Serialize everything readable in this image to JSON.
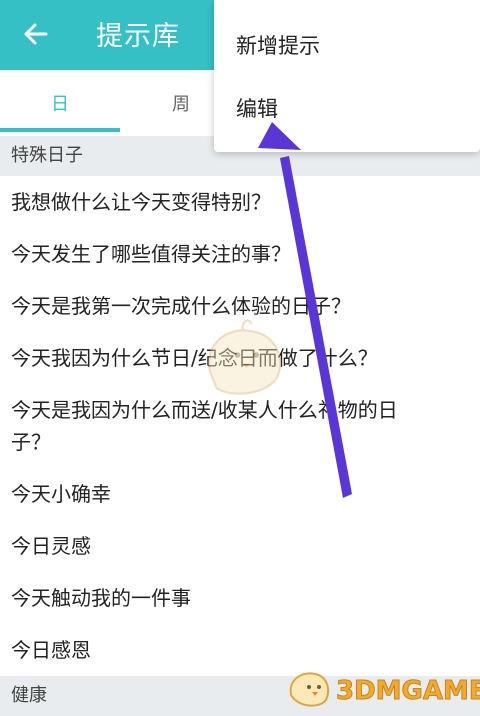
{
  "appbar": {
    "title": "提示库",
    "back_icon": "arrow-left-icon",
    "color": "#35c0c6"
  },
  "tabs": [
    {
      "label": "日",
      "active": true
    },
    {
      "label": "周",
      "active": false
    }
  ],
  "sections": [
    {
      "title": "特殊日子",
      "items": [
        "我想做什么让今天变得特别？",
        "今天发生了哪些值得关注的事？",
        "今天是我第一次完成什么体验的日子？",
        "今天我因为什么节日/纪念日而做了什么？",
        "今天是我因为什么而送/收某人什么礼物的日",
        "子？",
        "今天小确幸",
        "今日灵感",
        "今天触动我的一件事",
        "今日感恩"
      ]
    },
    {
      "title": "健康",
      "items": []
    }
  ],
  "menu": {
    "items": [
      "新增提示",
      "编辑"
    ]
  },
  "overlay": {
    "arrow_color": "#5b36d6"
  },
  "watermark": {
    "text": "3DMGAME"
  }
}
